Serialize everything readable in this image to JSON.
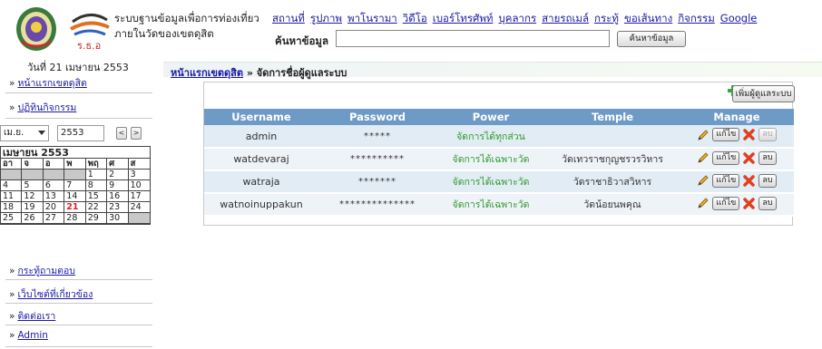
{
  "header": {
    "title_line1": "ระบบฐานข้อมูลเพื่อการท่องเที่ยว",
    "title_line2": "ภายในวัดของเขตดุสิต",
    "logo2_text": "ร.ธ.อ",
    "nav": [
      "สถานที่",
      "รูปภาพ",
      "พาโนรามา",
      "วิดีโอ",
      "เบอร์โทรศัพท์",
      "บุคลากร",
      "สายรถเมล์",
      "กระทู้",
      "ขอเส้นทาง",
      "กิจกรรม",
      "Google"
    ],
    "search_label": "ค้นหาข้อมูล",
    "search_value": "",
    "search_button": "ค้นหาข้อมูล"
  },
  "sidebar": {
    "date_text": "วันที่ 21 เมษายน 2553",
    "links_top": [
      {
        "arrow": "»",
        "label": "หน้าแรกเขตดุสิต"
      },
      {
        "arrow": "»",
        "label": "ปฏิทินกิจกรรม"
      }
    ],
    "calendar": {
      "month_select": "เม.ย.",
      "year_value": "2553",
      "prev_label": "<",
      "next_label": ">",
      "title": "เมษายน 2553",
      "weekdays": [
        "อา",
        "จ",
        "อ",
        "พ",
        "พฤ",
        "ศ",
        "ส"
      ],
      "days": [
        "",
        "",
        "",
        "",
        "1",
        "2",
        "3",
        "4",
        "5",
        "6",
        "7",
        "8",
        "9",
        "10",
        "11",
        "12",
        "13",
        "14",
        "15",
        "16",
        "17",
        "18",
        "19",
        "20",
        "21",
        "22",
        "23",
        "24",
        "25",
        "26",
        "27",
        "28",
        "29",
        "30",
        ""
      ],
      "today": "21"
    },
    "links_bottom": [
      {
        "arrow": "»",
        "label": "กระทู้ถามตอบ"
      },
      {
        "arrow": "»",
        "label": "เว็บไซต์ที่เกี่ยวข้อง"
      },
      {
        "arrow": "»",
        "label": "ติดต่อเรา"
      },
      {
        "arrow": "»",
        "label": "Admin"
      }
    ]
  },
  "main": {
    "breadcrumb_link": "หน้าแรกเขตดุสิต",
    "breadcrumb_sep": " » ",
    "breadcrumb_current": "จัดการชื่อผู้ดูแลระบบ",
    "add_button": "เพิ่มผู้ดูแลระบบ",
    "columns": [
      "Username",
      "Password",
      "Power",
      "Temple",
      "Manage"
    ],
    "edit_label": "แก้ไข",
    "delete_label": "ลบ",
    "rows": [
      {
        "username": "admin",
        "password": "*****",
        "power": "จัดการได้ทุกส่วน",
        "temple": "",
        "delete_enabled": false
      },
      {
        "username": "watdevaraj",
        "password": "**********",
        "power": "จัดการได้เฉพาะวัด",
        "temple": "วัดเทวราชกุญชรวรวิหาร",
        "delete_enabled": true
      },
      {
        "username": "watraja",
        "password": "*******",
        "power": "จัดการได้เฉพาะวัด",
        "temple": "วัดราชาธิวาสวิหาร",
        "delete_enabled": true
      },
      {
        "username": "watnoinuppakun",
        "password": "**************",
        "power": "จัดการได้เฉพาะวัด",
        "temple": "วัดน้อยนพคุณ",
        "delete_enabled": true
      }
    ]
  },
  "colors": {
    "header_row": "#6e9ac6",
    "power_text": "#2e9b2e",
    "link": "#1a1aa6",
    "today": "#e02020"
  },
  "icons": {
    "add": "green-plus-icon",
    "edit": "pencil-icon",
    "delete": "red-x-icon",
    "calendar_prev": "chevron-left-icon",
    "calendar_next": "chevron-right-icon"
  }
}
